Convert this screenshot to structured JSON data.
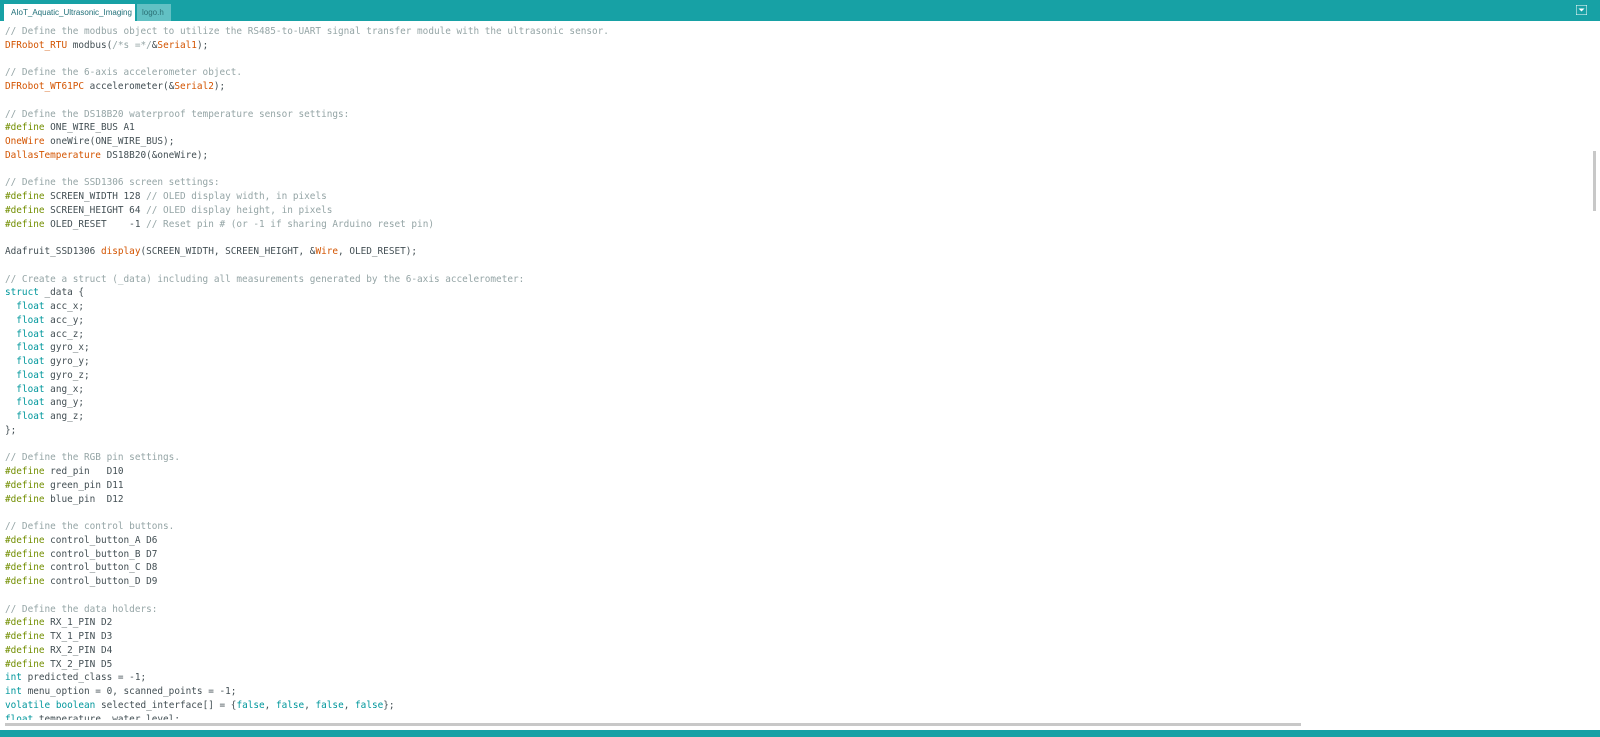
{
  "tabs": [
    {
      "label": "AIoT_Aquatic_Ultrasonic_Imaging",
      "active": true
    },
    {
      "label": "logo.h",
      "active": false
    }
  ],
  "tab_menu_icon": "chevron-down-icon",
  "colors": {
    "accent": "#17a1a5",
    "comment": "#95a5a6",
    "preprocessor": "#728e00",
    "keyword": "#00979c",
    "type": "#d35400",
    "text": "#434f54"
  },
  "code_lines": [
    [
      {
        "t": "// Define the modbus object to utilize the RS485-to-UART signal transfer module with the ultrasonic sensor.",
        "c": "cm"
      }
    ],
    [
      {
        "t": "DFRobot_RTU",
        "c": "ty"
      },
      {
        "t": " modbus("
      },
      {
        "t": "/*s =*/",
        "c": "cm"
      },
      {
        "t": "&"
      },
      {
        "t": "Serial1",
        "c": "bi"
      },
      {
        "t": ");"
      }
    ],
    [
      {
        "t": ""
      }
    ],
    [
      {
        "t": "// Define the 6-axis accelerometer object.",
        "c": "cm"
      }
    ],
    [
      {
        "t": "DFRobot_WT61PC",
        "c": "ty"
      },
      {
        "t": " accelerometer(&"
      },
      {
        "t": "Serial2",
        "c": "bi"
      },
      {
        "t": ");"
      }
    ],
    [
      {
        "t": ""
      }
    ],
    [
      {
        "t": "// Define the DS18B20 waterproof temperature sensor settings:",
        "c": "cm"
      }
    ],
    [
      {
        "t": "#define",
        "c": "pp"
      },
      {
        "t": " ONE_WIRE_BUS A1"
      }
    ],
    [
      {
        "t": "OneWire",
        "c": "ty"
      },
      {
        "t": " oneWire(ONE_WIRE_BUS);"
      }
    ],
    [
      {
        "t": "DallasTemperature",
        "c": "ty"
      },
      {
        "t": " DS18B20(&oneWire);"
      }
    ],
    [
      {
        "t": ""
      }
    ],
    [
      {
        "t": "// Define the SSD1306 screen settings:",
        "c": "cm"
      }
    ],
    [
      {
        "t": "#define",
        "c": "pp"
      },
      {
        "t": " SCREEN_WIDTH 128 "
      },
      {
        "t": "// OLED display width, in pixels",
        "c": "cm"
      }
    ],
    [
      {
        "t": "#define",
        "c": "pp"
      },
      {
        "t": " SCREEN_HEIGHT 64 "
      },
      {
        "t": "// OLED display height, in pixels",
        "c": "cm"
      }
    ],
    [
      {
        "t": "#define",
        "c": "pp"
      },
      {
        "t": " OLED_RESET    -1 "
      },
      {
        "t": "// Reset pin # (or -1 if sharing Arduino reset pin)",
        "c": "cm"
      }
    ],
    [
      {
        "t": ""
      }
    ],
    [
      {
        "t": "Adafruit_SSD1306 "
      },
      {
        "t": "display",
        "c": "bi"
      },
      {
        "t": "(SCREEN_WIDTH, SCREEN_HEIGHT, &"
      },
      {
        "t": "Wire",
        "c": "bi"
      },
      {
        "t": ", OLED_RESET);"
      }
    ],
    [
      {
        "t": ""
      }
    ],
    [
      {
        "t": "// Create a struct (_data) including all measurements generated by the 6-axis accelerometer:",
        "c": "cm"
      }
    ],
    [
      {
        "t": "struct",
        "c": "kw"
      },
      {
        "t": " _data {"
      }
    ],
    [
      {
        "t": "  "
      },
      {
        "t": "float",
        "c": "kw"
      },
      {
        "t": " acc_x;"
      }
    ],
    [
      {
        "t": "  "
      },
      {
        "t": "float",
        "c": "kw"
      },
      {
        "t": " acc_y;"
      }
    ],
    [
      {
        "t": "  "
      },
      {
        "t": "float",
        "c": "kw"
      },
      {
        "t": " acc_z;"
      }
    ],
    [
      {
        "t": "  "
      },
      {
        "t": "float",
        "c": "kw"
      },
      {
        "t": " gyro_x;"
      }
    ],
    [
      {
        "t": "  "
      },
      {
        "t": "float",
        "c": "kw"
      },
      {
        "t": " gyro_y;"
      }
    ],
    [
      {
        "t": "  "
      },
      {
        "t": "float",
        "c": "kw"
      },
      {
        "t": " gyro_z;"
      }
    ],
    [
      {
        "t": "  "
      },
      {
        "t": "float",
        "c": "kw"
      },
      {
        "t": " ang_x;"
      }
    ],
    [
      {
        "t": "  "
      },
      {
        "t": "float",
        "c": "kw"
      },
      {
        "t": " ang_y;"
      }
    ],
    [
      {
        "t": "  "
      },
      {
        "t": "float",
        "c": "kw"
      },
      {
        "t": " ang_z;"
      }
    ],
    [
      {
        "t": "};"
      }
    ],
    [
      {
        "t": ""
      }
    ],
    [
      {
        "t": "// Define the RGB pin settings.",
        "c": "cm"
      }
    ],
    [
      {
        "t": "#define",
        "c": "pp"
      },
      {
        "t": " red_pin   D10"
      }
    ],
    [
      {
        "t": "#define",
        "c": "pp"
      },
      {
        "t": " green_pin D11"
      }
    ],
    [
      {
        "t": "#define",
        "c": "pp"
      },
      {
        "t": " blue_pin  D12"
      }
    ],
    [
      {
        "t": ""
      }
    ],
    [
      {
        "t": "// Define the control buttons.",
        "c": "cm"
      }
    ],
    [
      {
        "t": "#define",
        "c": "pp"
      },
      {
        "t": " control_button_A D6"
      }
    ],
    [
      {
        "t": "#define",
        "c": "pp"
      },
      {
        "t": " control_button_B D7"
      }
    ],
    [
      {
        "t": "#define",
        "c": "pp"
      },
      {
        "t": " control_button_C D8"
      }
    ],
    [
      {
        "t": "#define",
        "c": "pp"
      },
      {
        "t": " control_button_D D9"
      }
    ],
    [
      {
        "t": ""
      }
    ],
    [
      {
        "t": "// Define the data holders:",
        "c": "cm"
      }
    ],
    [
      {
        "t": "#define",
        "c": "pp"
      },
      {
        "t": " RX_1_PIN D2"
      }
    ],
    [
      {
        "t": "#define",
        "c": "pp"
      },
      {
        "t": " TX_1_PIN D3"
      }
    ],
    [
      {
        "t": "#define",
        "c": "pp"
      },
      {
        "t": " RX_2_PIN D4"
      }
    ],
    [
      {
        "t": "#define",
        "c": "pp"
      },
      {
        "t": " TX_2_PIN D5"
      }
    ],
    [
      {
        "t": "int",
        "c": "kw"
      },
      {
        "t": " predicted_class = -1;"
      }
    ],
    [
      {
        "t": "int",
        "c": "kw"
      },
      {
        "t": " menu_option = 0, scanned_points = -1;"
      }
    ],
    [
      {
        "t": "volatile",
        "c": "kw"
      },
      {
        "t": " "
      },
      {
        "t": "boolean",
        "c": "kw"
      },
      {
        "t": " selected_interface[] = {"
      },
      {
        "t": "false",
        "c": "kw"
      },
      {
        "t": ", "
      },
      {
        "t": "false",
        "c": "kw"
      },
      {
        "t": ", "
      },
      {
        "t": "false",
        "c": "kw"
      },
      {
        "t": ", "
      },
      {
        "t": "false",
        "c": "kw"
      },
      {
        "t": "};"
      }
    ],
    [
      {
        "t": "float",
        "c": "kw"
      },
      {
        "t": " temperature, water_level;"
      }
    ]
  ]
}
